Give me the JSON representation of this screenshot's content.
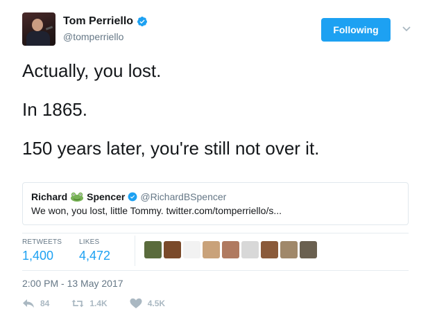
{
  "author": {
    "display_name": "Tom Perriello",
    "handle": "@tomperriello",
    "verified": true
  },
  "follow_button": {
    "label": "Following",
    "color": "#1da1f2"
  },
  "tweet": {
    "lines": [
      "Actually, you lost.",
      "In 1865.",
      "150 years later, you're still not over it."
    ]
  },
  "quoted_tweet": {
    "name_first": "Richard",
    "name_emoji": "frog-emoji",
    "name_last": "Spencer",
    "verified": true,
    "handle": "@RichardBSpencer",
    "text": "We won, you lost, little Tommy. twitter.com/tomperriello/s..."
  },
  "stats": {
    "retweets_label": "RETWEETS",
    "retweets_value": "1,400",
    "likes_label": "LIKES",
    "likes_value": "4,472"
  },
  "likers": [
    {
      "icon": "liker-avatar-1",
      "color": "#5a6b3c"
    },
    {
      "icon": "liker-avatar-2",
      "color": "#7a4a2a"
    },
    {
      "icon": "liker-avatar-3",
      "color": "#f2f2f2"
    },
    {
      "icon": "liker-avatar-4",
      "color": "#c9a27a"
    },
    {
      "icon": "liker-avatar-5",
      "color": "#b07a60"
    },
    {
      "icon": "liker-avatar-6",
      "color": "#d8d8d8"
    },
    {
      "icon": "liker-avatar-7",
      "color": "#8a5a3a"
    },
    {
      "icon": "liker-avatar-8",
      "color": "#a0886a"
    },
    {
      "icon": "liker-avatar-9",
      "color": "#6a6050"
    }
  ],
  "timestamp": "2:00 PM - 13 May 2017",
  "actions": {
    "reply_count": "84",
    "retweet_count": "1.4K",
    "like_count": "4.5K"
  },
  "colors": {
    "accent": "#1da1f2",
    "muted": "#657786",
    "action_muted": "#aab8c2"
  }
}
